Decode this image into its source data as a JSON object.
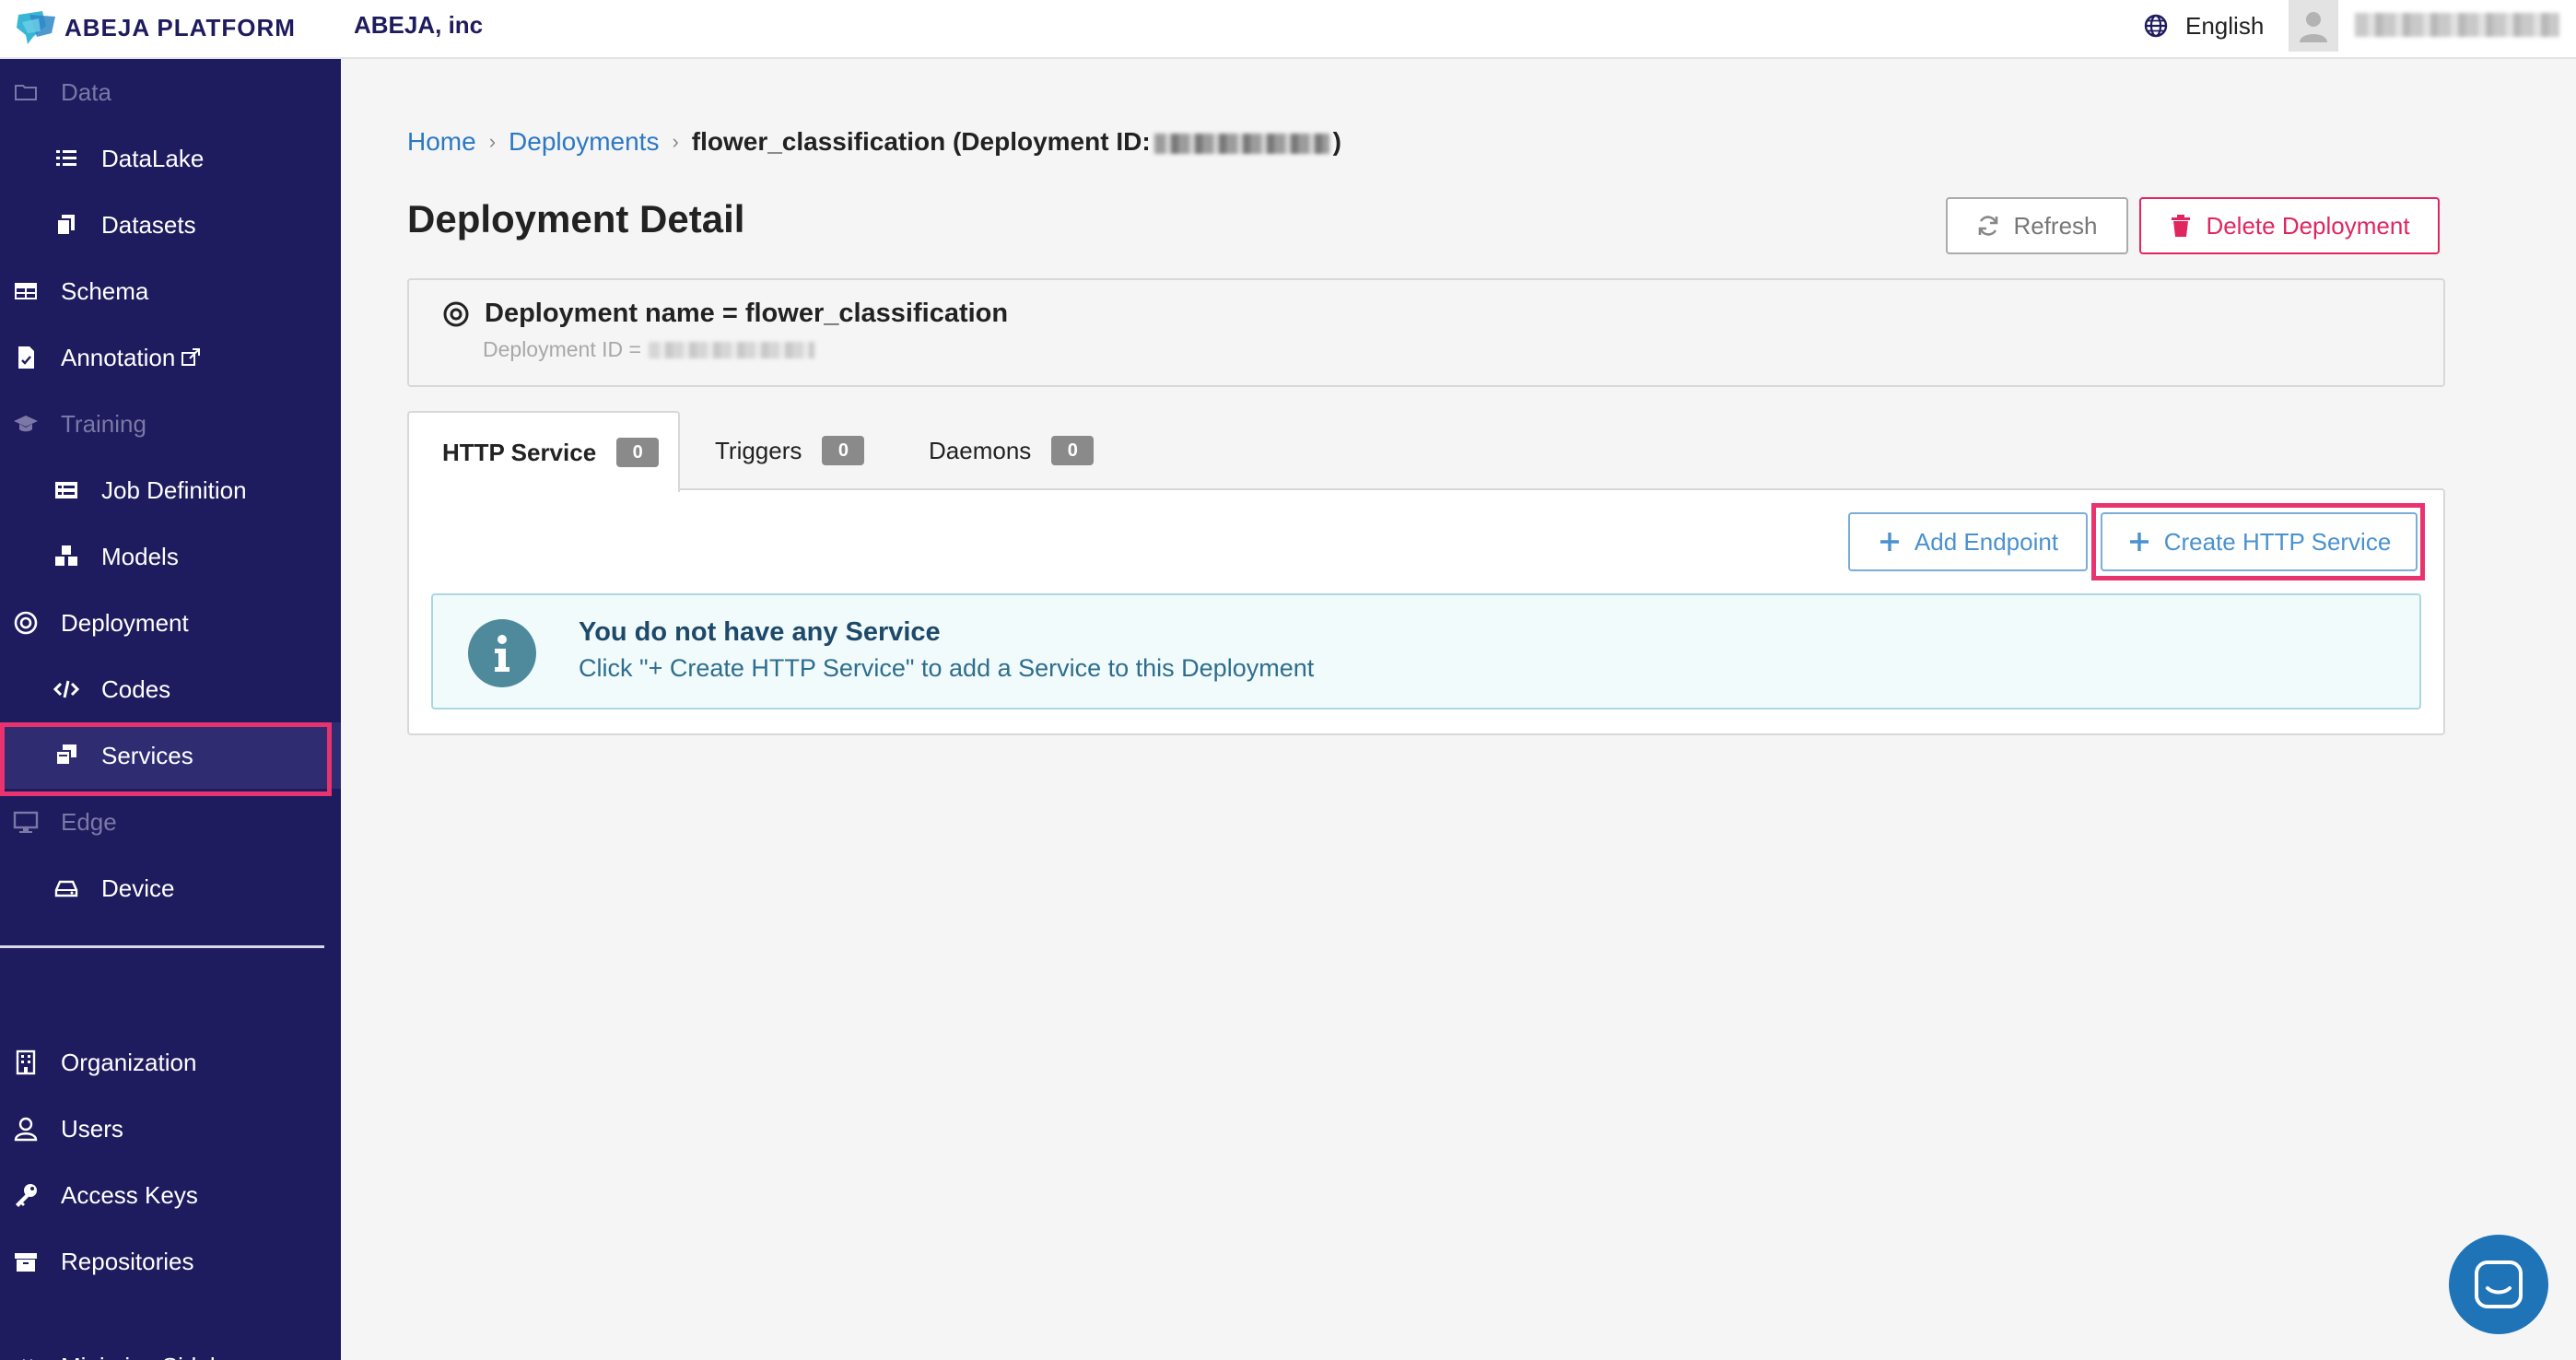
{
  "topbar": {
    "logo_text": "ABEJA PLATFORM",
    "org_name": "ABEJA, inc",
    "language": "English"
  },
  "sidebar": {
    "data_category": "Data",
    "datalake": "DataLake",
    "datasets": "Datasets",
    "schema": "Schema",
    "annotation": "Annotation",
    "training_category": "Training",
    "job_definition": "Job Definition",
    "models": "Models",
    "deployment": "Deployment",
    "codes": "Codes",
    "services": "Services",
    "edge_category": "Edge",
    "device": "Device",
    "organization": "Organization",
    "users": "Users",
    "access_keys": "Access Keys",
    "repositories": "Repositories",
    "minimize": "Minimize Sidebar"
  },
  "breadcrumb": {
    "home": "Home",
    "deployments": "Deployments",
    "current_prefix": "flower_classification (Deployment ID:",
    "current_suffix": ")"
  },
  "page": {
    "title": "Deployment Detail",
    "refresh_label": "Refresh",
    "delete_label": "Delete Deployment"
  },
  "deployment": {
    "name_line": "Deployment name = flower_classification",
    "id_label": "Deployment ID ="
  },
  "tabs": [
    {
      "label": "HTTP Service",
      "count": "0"
    },
    {
      "label": "Triggers",
      "count": "0"
    },
    {
      "label": "Daemons",
      "count": "0"
    }
  ],
  "panel": {
    "add_endpoint_label": "Add Endpoint",
    "create_http_label": "Create HTTP Service"
  },
  "info": {
    "title": "You do not have any Service",
    "text": "Click \"+ Create HTTP Service\" to add a Service to this Deployment"
  },
  "colors": {
    "sidebar_bg": "#1e1b5e",
    "link": "#2b78c6",
    "danger": "#e0265f",
    "highlight": "#e8336e",
    "info_bg": "#f2fbfc",
    "chat": "#1f73b7"
  }
}
